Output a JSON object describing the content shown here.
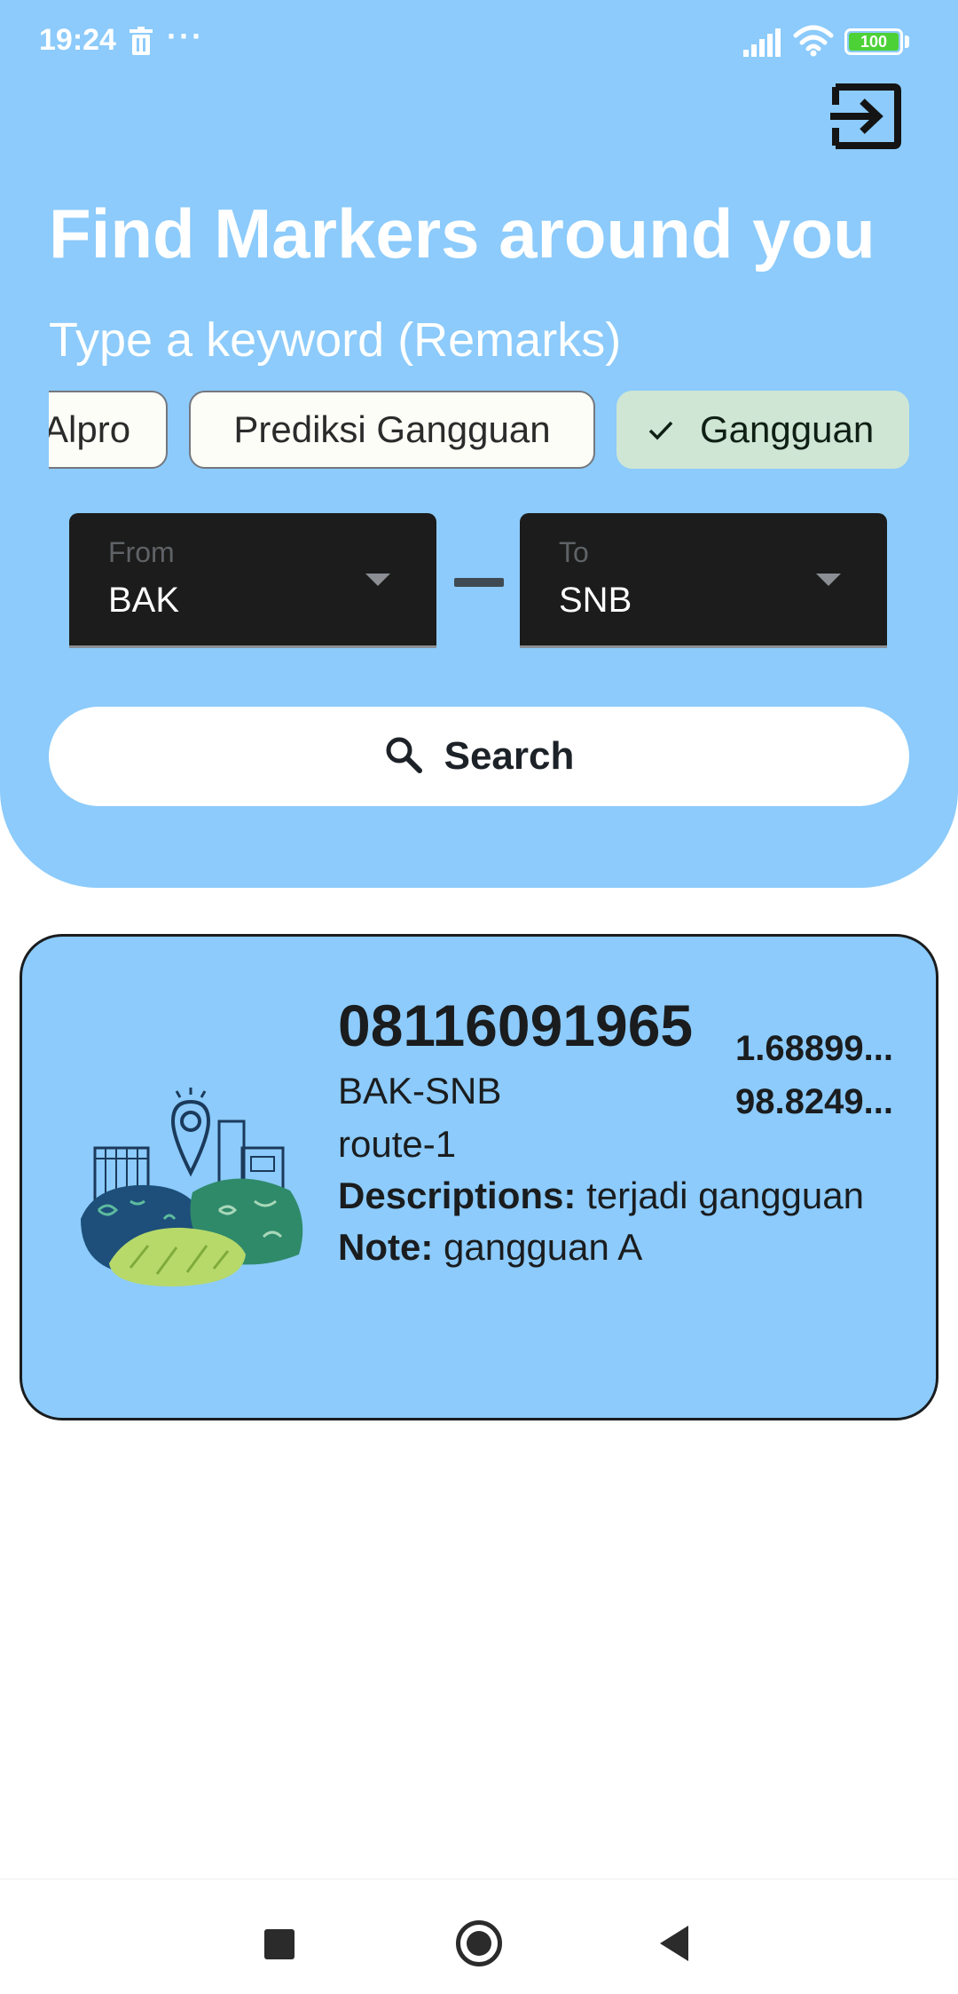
{
  "status_bar": {
    "time": "19:24",
    "more_indicator": "···",
    "battery_level": "100",
    "icons": [
      "trash-icon",
      "signal-icon",
      "wifi-icon",
      "battery-icon"
    ]
  },
  "header": {
    "title": "Find Markers around you",
    "keyword_placeholder": "Type a keyword (Remarks)",
    "logout_icon": "logout-icon"
  },
  "filter_chips": [
    {
      "label": "Alpro",
      "selected": false
    },
    {
      "label": "Prediksi Gangguan",
      "selected": false
    },
    {
      "label": "Gangguan",
      "selected": true
    }
  ],
  "route": {
    "from": {
      "label": "From",
      "value": "BAK"
    },
    "to": {
      "label": "To",
      "value": "SNB"
    }
  },
  "search": {
    "label": "Search",
    "icon": "search-icon"
  },
  "results": [
    {
      "phone": "08116091965",
      "lat": "1.68899...",
      "lng": "98.8249...",
      "route": "BAK-SNB",
      "sub_route": "route-1",
      "descriptions_label": "Descriptions:",
      "descriptions": "terjadi gangguan",
      "note_label": "Note:",
      "note": "gangguan A"
    }
  ],
  "colors": {
    "header_bg": "#8ccbfb",
    "card_bg": "#8ccbfb",
    "chip_selected_bg": "#cfe6d5",
    "field_bg": "#1b1c1b"
  },
  "nav_bar": {
    "icons": [
      "recents-icon",
      "home-icon",
      "back-icon"
    ]
  }
}
